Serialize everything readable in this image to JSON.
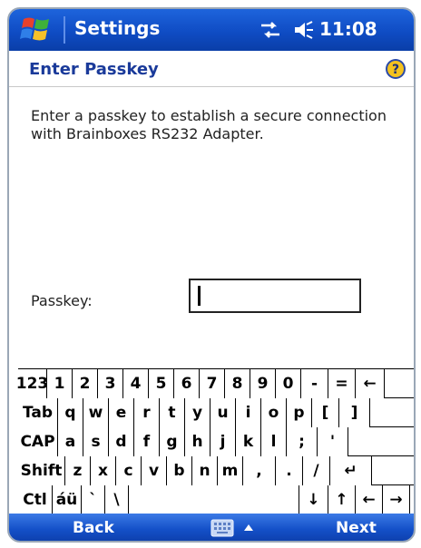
{
  "statusbar": {
    "title": "Settings",
    "time": "11:08",
    "icons": [
      "windows-start-icon",
      "connectivity-icon",
      "speaker-icon"
    ]
  },
  "header": {
    "title": "Enter Passkey",
    "help_icon": "help-icon"
  },
  "main": {
    "instructions": "Enter a passkey to establish a secure connection with Brainboxes RS232 Adapter.",
    "passkey_label": "Passkey:",
    "passkey_value": ""
  },
  "keyboard": {
    "rows": [
      [
        "123",
        "1",
        "2",
        "3",
        "4",
        "5",
        "6",
        "7",
        "8",
        "9",
        "0",
        "-",
        "=",
        "←"
      ],
      [
        "Tab",
        "q",
        "w",
        "e",
        "r",
        "t",
        "y",
        "u",
        "i",
        "o",
        "p",
        "[",
        "]"
      ],
      [
        "CAP",
        "a",
        "s",
        "d",
        "f",
        "g",
        "h",
        "j",
        "k",
        "l",
        ";",
        "'"
      ],
      [
        "Shift",
        "z",
        "x",
        "c",
        "v",
        "b",
        "n",
        "m",
        ",",
        ".",
        "/",
        "↵"
      ],
      [
        "Ctl",
        "áü",
        "`",
        "\\",
        "",
        "↓",
        "↑",
        "←",
        "→"
      ]
    ]
  },
  "bottombar": {
    "left_softkey": "Back",
    "right_softkey": "Next",
    "keyboard_icon": "keyboard-icon"
  },
  "colors": {
    "titlebar": "#0f4cc4",
    "header_text": "#1a3a9a",
    "bottombar": "#1450c8"
  }
}
